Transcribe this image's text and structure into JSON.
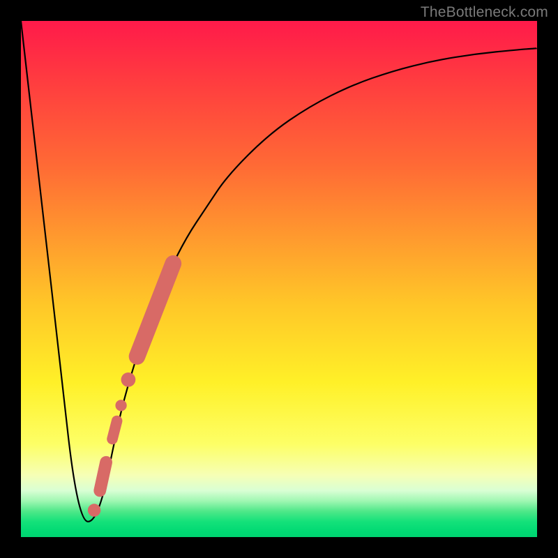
{
  "watermark": {
    "text": "TheBottleneck.com"
  },
  "colors": {
    "curve_stroke": "#000000",
    "marker_fill": "#d86a66",
    "gradient_top": "#ff1a4a",
    "gradient_bottom": "#00d471",
    "frame_bg": "#000000"
  },
  "chart_data": {
    "type": "line",
    "title": "",
    "xlabel": "",
    "ylabel": "",
    "xlim": [
      0,
      100
    ],
    "ylim": [
      0,
      100
    ],
    "grid": false,
    "series": [
      {
        "name": "bottleneck-curve",
        "x": [
          0,
          4,
          8,
          10,
          12,
          14,
          16,
          18,
          20,
          24,
          28,
          32,
          36,
          40,
          48,
          56,
          64,
          72,
          80,
          88,
          96,
          100
        ],
        "y": [
          100,
          65,
          30,
          12,
          3,
          3,
          8,
          18,
          27,
          40,
          50,
          58,
          64,
          70,
          78,
          83.5,
          87.5,
          90.3,
          92.3,
          93.6,
          94.4,
          94.7
        ]
      }
    ],
    "markers": [
      {
        "name": "band-dense",
        "type": "thick-line",
        "x0": 22.5,
        "y0": 35,
        "x1": 29.5,
        "y1": 53,
        "width": 3.2
      },
      {
        "name": "dot-a",
        "type": "dot",
        "x": 20.8,
        "y": 30.5,
        "r": 1.4
      },
      {
        "name": "dot-b",
        "type": "dot",
        "x": 19.4,
        "y": 25.5,
        "r": 1.1
      },
      {
        "name": "blob-c",
        "type": "thick-line",
        "x0": 17.7,
        "y0": 19,
        "x1": 18.6,
        "y1": 22.5,
        "width": 2.1
      },
      {
        "name": "blob-d",
        "type": "thick-line",
        "x0": 15.3,
        "y0": 9,
        "x1": 16.5,
        "y1": 14.5,
        "width": 2.4
      },
      {
        "name": "dot-e",
        "type": "dot",
        "x": 14.2,
        "y": 5.2,
        "r": 1.25
      }
    ]
  }
}
